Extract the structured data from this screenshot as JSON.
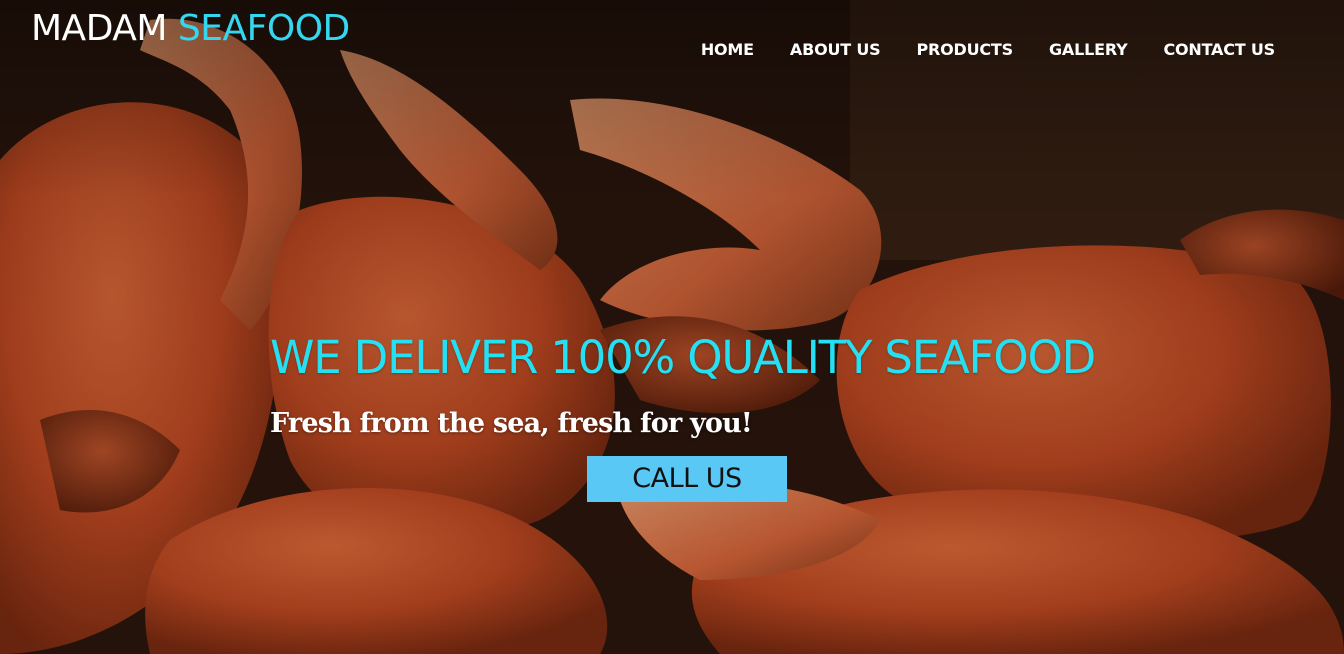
{
  "brand": {
    "word1": "MADAM",
    "word2": "SEAFOOD",
    "word1_color": "#ffffff",
    "word2_color": "#35d6ef"
  },
  "nav": {
    "items": [
      {
        "label": "HOME"
      },
      {
        "label": "ABOUT US"
      },
      {
        "label": "PRODUCTS"
      },
      {
        "label": "GALLERY"
      },
      {
        "label": "CONTACT US"
      }
    ]
  },
  "hero": {
    "headline": "WE DELIVER 100% QUALITY SEAFOOD",
    "subheadline": "Fresh from the sea, fresh for you!",
    "cta_label": "CALL US",
    "background_image": "crabs-photo",
    "headline_color": "#25dff2",
    "cta_color": "#5ac8f5"
  }
}
